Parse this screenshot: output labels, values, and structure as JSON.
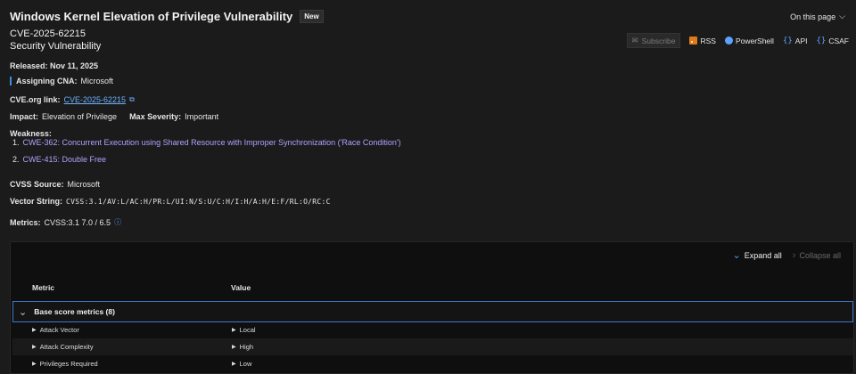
{
  "header": {
    "title": "Windows Kernel Elevation of Privilege Vulnerability",
    "badge": "New",
    "on_this_page": "On this page",
    "cve_id": "CVE-2025-62215",
    "cve_type": "Security Vulnerability"
  },
  "actions": {
    "subscribe": "Subscribe",
    "rss": "RSS",
    "powershell": "PowerShell",
    "api": "API",
    "csaf": "CSAF"
  },
  "details": {
    "released_label": "Released: Nov 11, 2025",
    "cna_label": "Assigning CNA:",
    "cna_value": "Microsoft",
    "cveorg_label": "CVE.org link:",
    "cveorg_value": "CVE-2025-62215",
    "impact_label": "Impact:",
    "impact_value": "Elevation of Privilege",
    "severity_label": "Max Severity:",
    "severity_value": "Important",
    "weakness_label": "Weakness:",
    "weaknesses": [
      {
        "num": "1.",
        "text": "CWE-362: Concurrent Execution using Shared Resource with Improper Synchronization ('Race Condition')"
      },
      {
        "num": "2.",
        "text": "CWE-415: Double Free"
      }
    ],
    "cvss_source_label": "CVSS Source:",
    "cvss_source_value": "Microsoft",
    "vector_label": "Vector String:",
    "vector_value": "CVSS:3.1/AV:L/AC:H/PR:L/UI:N/S:U/C:H/I:H/A:H/E:F/RL:O/RC:C",
    "metrics_label": "Metrics:",
    "metrics_value": "CVSS:3.1 7.0 / 6.5"
  },
  "table": {
    "expand_all": "Expand all",
    "collapse_all": "Collapse all",
    "col_metric": "Metric",
    "col_value": "Value",
    "group_label": "Base score metrics (8)",
    "rows": [
      {
        "metric": "Attack Vector",
        "value": "Local"
      },
      {
        "metric": "Attack Complexity",
        "value": "High"
      },
      {
        "metric": "Privileges Required",
        "value": "Low"
      }
    ]
  },
  "colors": {
    "accent": "#4f9cff",
    "link": "#6cb3ff",
    "cwe_link": "#b0a2ff",
    "background": "#1b1b1b"
  }
}
